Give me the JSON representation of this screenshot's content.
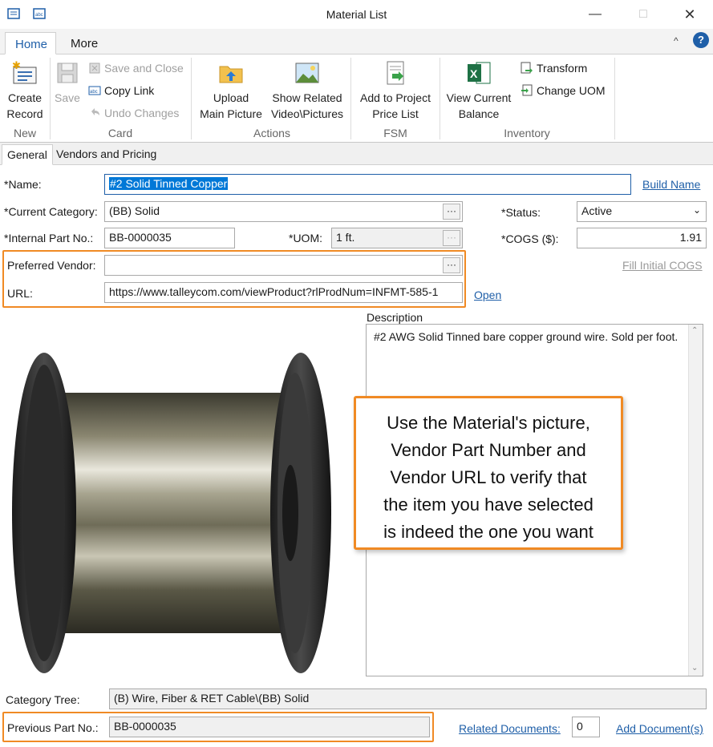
{
  "window": {
    "title": "Material List",
    "minimize_icon": "minimize-icon",
    "maximize_icon": "maximize-icon",
    "close_icon": "close-icon"
  },
  "ribbon": {
    "tabs": [
      {
        "label": "Home",
        "active": true
      },
      {
        "label": "More",
        "active": false
      }
    ],
    "collapse_icon": "chevron-up-icon",
    "groups": {
      "new": {
        "label": "New",
        "create_record": {
          "label1": "Create",
          "label2": "Record",
          "icon": "new-record-icon"
        }
      },
      "card": {
        "label": "Card",
        "save": {
          "label": "Save",
          "icon": "save-icon",
          "enabled": false
        },
        "save_and_close": {
          "label": "Save and Close",
          "icon": "save-close-icon",
          "enabled": false
        },
        "copy_link": {
          "label": "Copy Link",
          "icon": "copy-link-icon",
          "enabled": true
        },
        "undo_changes": {
          "label": "Undo Changes",
          "icon": "undo-icon",
          "enabled": false
        }
      },
      "actions": {
        "label": "Actions",
        "upload_main_picture": {
          "label1": "Upload",
          "label2": "Main Picture",
          "icon": "folder-upload-icon"
        },
        "show_related": {
          "label1": "Show Related",
          "label2": "Video\\Pictures",
          "icon": "picture-icon"
        }
      },
      "fsm": {
        "label": "FSM",
        "add_to_price_list": {
          "label1": "Add to Project",
          "label2": "Price List",
          "icon": "document-add-icon"
        }
      },
      "inventory": {
        "label": "Inventory",
        "view_current_balance": {
          "label1": "View Current",
          "label2": "Balance",
          "icon": "excel-icon"
        },
        "transform": {
          "label": "Transform",
          "icon": "transform-icon"
        },
        "change_uom": {
          "label": "Change UOM",
          "icon": "change-uom-icon"
        }
      }
    }
  },
  "content_tabs": [
    {
      "label": "General",
      "active": true
    },
    {
      "label": "Vendors and Pricing",
      "active": false
    }
  ],
  "form": {
    "name": {
      "label": "*Name:",
      "value": "#2 Solid Tinned Copper"
    },
    "build_name": "Build Name",
    "current_category": {
      "label": "*Current Category:",
      "value": "(BB) Solid"
    },
    "status": {
      "label": "*Status:",
      "value": "Active"
    },
    "internal_part_no": {
      "label": "*Internal Part No.:",
      "value": "BB-0000035"
    },
    "uom": {
      "label": "*UOM:",
      "value": "1 ft."
    },
    "cogs": {
      "label": "*COGS ($):",
      "value": "1.91"
    },
    "preferred_vendor": {
      "label": "Preferred Vendor:",
      "value": ""
    },
    "fill_initial_cogs": "Fill Initial COGS",
    "url": {
      "label": "URL:",
      "value": "https://www.talleycom.com/viewProduct?rlProdNum=INFMT-585-1"
    },
    "open_link": "Open",
    "description": {
      "label": "Description",
      "value": "#2 AWG Solid Tinned bare copper ground wire. Sold per foot."
    },
    "category_tree": {
      "label": "Category Tree:",
      "value": "(B) Wire, Fiber & RET Cable\\(BB) Solid"
    },
    "previous_part_no": {
      "label": "Previous Part No.:",
      "value": "BB-0000035"
    },
    "related_documents": {
      "label": "Related Documents:",
      "count": "0"
    },
    "add_documents": "Add Document(s)"
  },
  "callout": {
    "lines": [
      "Use the Material's picture,",
      "Vendor Part Number and",
      "Vendor URL to verify that",
      "the item you have selected",
      "is indeed the one you want"
    ]
  },
  "picture": {
    "icon": "wire-spool-picture"
  },
  "colors": {
    "accent": "#1f5fa8",
    "highlight": "#f08a24",
    "selection": "#0078d7"
  }
}
